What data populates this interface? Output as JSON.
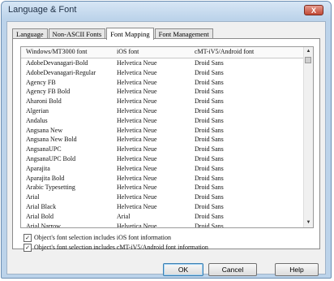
{
  "window": {
    "title": "Language & Font",
    "close_label": "X"
  },
  "tabs": [
    "Language",
    "Non-ASCII Fonts",
    "Font Mapping",
    "Font Management"
  ],
  "active_tab": "Font Mapping",
  "table": {
    "columns": [
      "Windows/MT3000 font",
      "iOS font",
      "cMT-iV5/Android font"
    ],
    "rows": [
      [
        "AdobeDevanagari-Bold",
        "Helvetica Neue",
        "Droid Sans"
      ],
      [
        "AdobeDevanagari-Regular",
        "Helvetica Neue",
        "Droid Sans"
      ],
      [
        "Agency FB",
        "Helvetica Neue",
        "Droid Sans"
      ],
      [
        "Agency FB Bold",
        "Helvetica Neue",
        "Droid Sans"
      ],
      [
        "Aharoni Bold",
        "Helvetica Neue",
        "Droid Sans"
      ],
      [
        "Algerian",
        "Helvetica Neue",
        "Droid Sans"
      ],
      [
        "Andalus",
        "Helvetica Neue",
        "Droid Sans"
      ],
      [
        "Angsana New",
        "Helvetica Neue",
        "Droid Sans"
      ],
      [
        "Angsana New Bold",
        "Helvetica Neue",
        "Droid Sans"
      ],
      [
        "AngsanaUPC",
        "Helvetica Neue",
        "Droid Sans"
      ],
      [
        "AngsanaUPC Bold",
        "Helvetica Neue",
        "Droid Sans"
      ],
      [
        "Aparajita",
        "Helvetica Neue",
        "Droid Sans"
      ],
      [
        "Aparajita Bold",
        "Helvetica Neue",
        "Droid Sans"
      ],
      [
        "Arabic Typesetting",
        "Helvetica Neue",
        "Droid Sans"
      ],
      [
        "Arial",
        "Helvetica Neue",
        "Droid Sans"
      ],
      [
        "Arial Black",
        "Helvetica Neue",
        "Droid Sans"
      ],
      [
        "Arial Bold",
        "Arial",
        "Droid Sans"
      ],
      [
        "Arial Narrow",
        "Helvetica Neue",
        "Droid Sans"
      ]
    ]
  },
  "options": [
    {
      "label": "Object's font selection includes iOS font information",
      "checked": true,
      "mark": "✓"
    },
    {
      "label": "Object's font selection includes cMT-iV5/Android font information",
      "checked": true,
      "mark": "✓"
    }
  ],
  "buttons": {
    "ok": "OK",
    "cancel": "Cancel",
    "help": "Help"
  },
  "scroll": {
    "up": "▲",
    "down": "▼"
  }
}
